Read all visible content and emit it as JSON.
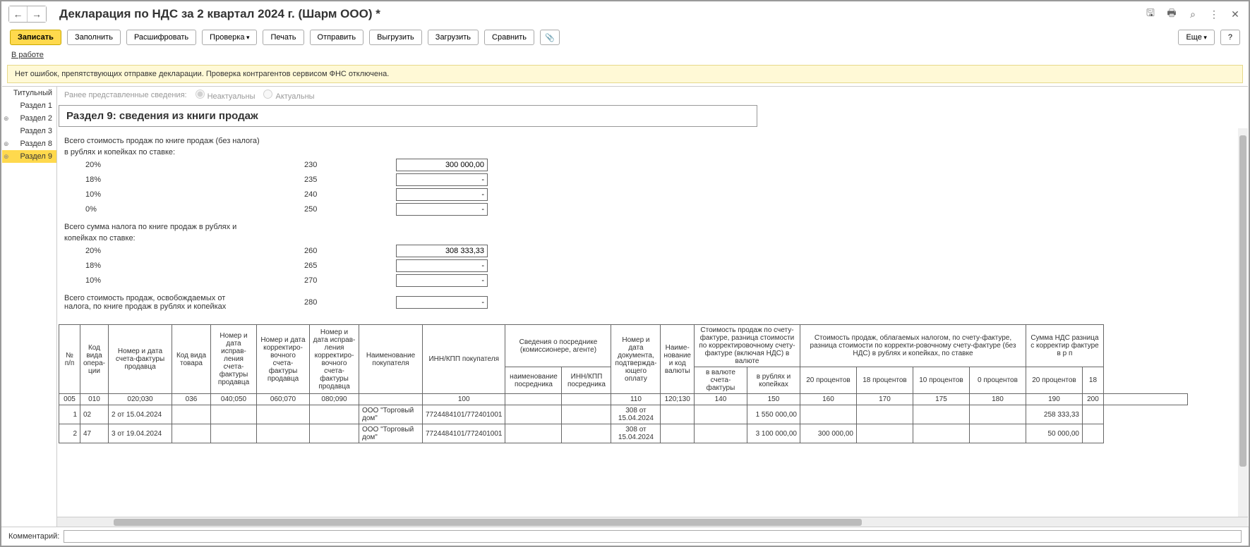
{
  "title": "Декларация по НДС за 2 квартал 2024 г. (Шарм ООО) *",
  "nav": {
    "back": "←",
    "fwd": "→"
  },
  "toolbar": {
    "write": "Записать",
    "fill": "Заполнить",
    "decrypt": "Расшифровать",
    "check": "Проверка",
    "print": "Печать",
    "send": "Отправить",
    "upload": "Выгрузить",
    "download": "Загрузить",
    "compare": "Сравнить",
    "more": "Еще",
    "help": "?"
  },
  "status": "В работе",
  "info": "Нет ошибок, препятствующих отправке декларации. Проверка контрагентов сервисом ФНС отключена.",
  "sidebar": [
    "Титульный",
    "Раздел 1",
    "Раздел 2",
    "Раздел 3",
    "Раздел 8",
    "Раздел 9"
  ],
  "radio": {
    "label": "Ранее представленные сведения:",
    "opt1": "Неактуальны",
    "opt2": "Актуальны"
  },
  "section_title": "Раздел 9: сведения из книги продаж",
  "labels": {
    "cost_no_tax": "Всего стоимость продаж по книге продаж (без налога)",
    "rub_rate": "в рублях и копейках по ставке:",
    "tax_sum": "Всего сумма налога по книге продаж в рублях и",
    "kopeck_rate": "копейках по ставке:",
    "exempt1": "Всего стоимость продаж, освобождаемых от",
    "exempt2": "налога, по книге продаж в рублях и копейках"
  },
  "rows": [
    {
      "pct": "20%",
      "code": "230",
      "val": "300 000,00"
    },
    {
      "pct": "18%",
      "code": "235",
      "val": "-"
    },
    {
      "pct": "10%",
      "code": "240",
      "val": "-"
    },
    {
      "pct": "0%",
      "code": "250",
      "val": "-"
    }
  ],
  "rows2": [
    {
      "pct": "20%",
      "code": "260",
      "val": "308 333,33"
    },
    {
      "pct": "18%",
      "code": "265",
      "val": "-"
    },
    {
      "pct": "10%",
      "code": "270",
      "val": "-"
    }
  ],
  "row_exempt": {
    "code": "280",
    "val": "-"
  },
  "table": {
    "headers": {
      "h1": "№ п/п",
      "h2": "Код вида опера-ции",
      "h3": "Номер и дата счета-фактуры продавца",
      "h4": "Код вида товара",
      "h5": "Номер и дата исправ-ления счета-фактуры продавца",
      "h6": "Номер и дата корректиро-вочного счета-фактуры продавца",
      "h7": "Номер и дата исправ-ления корректиро-вочного счета-фактуры продавца",
      "h8": "Наименование покупателя",
      "h9": "ИНН/КПП покупателя",
      "h10": "Сведения о посреднике (комиссионере, агенте)",
      "h11": "Номер и дата документа, подтвержда-ющего оплату",
      "h12": "Наиме-нование и код валюты",
      "h13": "Стоимость продаж по счету-фактуре, разница стоимости по корректировочному счету-фактуре (включая НДС) в валюте",
      "h14": "Стоимость продаж, облагаемых налогом, по счету-фактуре, разница стоимости по корректи-ровочному счету-фактуре (без НДС) в рублях и копейках, по ставке",
      "h15": "Сумма НДС разница с корректир фактуре в р п",
      "sub1": "наименование посредника",
      "sub2": "ИНН/КПП посредника",
      "sub3": "в валюте счета-фактуры",
      "sub4": "в рублях и копейках",
      "sub5": "20 процентов",
      "sub6": "18 процентов",
      "sub7": "10 процентов",
      "sub8": "0 процентов",
      "sub9": "20 процентов",
      "sub10": "18"
    },
    "codes": [
      "005",
      "010",
      "020;030",
      "036",
      "040;050",
      "060;070",
      "080;090",
      "",
      "100",
      "",
      "",
      "110",
      "120;130",
      "140",
      "150",
      "160",
      "170",
      "175",
      "180",
      "190",
      "200",
      ""
    ],
    "data": [
      {
        "n": "1",
        "op": "02",
        "sf": "2 от 15.04.2024",
        "buyer": "ООО \"Торговый дом\"",
        "inn": "7724484101/772401001",
        "doc": "308 от 15.04.2024",
        "rub": "1 550 000,00",
        "p20": "",
        "ndc20": "258 333,33"
      },
      {
        "n": "2",
        "op": "47",
        "sf": "3 от 19.04.2024",
        "buyer": "ООО \"Торговый дом\"",
        "inn": "7724484101/772401001",
        "doc": "308 от 15.04.2024",
        "rub": "3 100 000,00",
        "p20": "300 000,00",
        "ndc20": "50 000,00"
      }
    ]
  },
  "comment_label": "Комментарий:"
}
